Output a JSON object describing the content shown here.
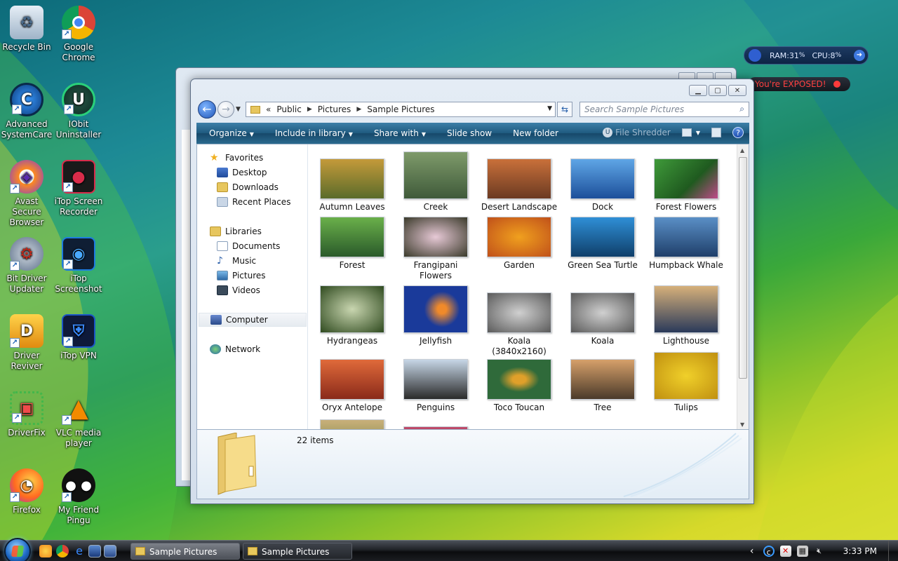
{
  "desktop": {
    "icons": [
      {
        "label": "Recycle Bin",
        "icon": "recycle-bin-icon",
        "color": "#7fa6c8"
      },
      {
        "label": "Google Chrome",
        "icon": "chrome-icon",
        "color": "#e14b3b"
      },
      {
        "label": "Advanced SystemCare",
        "icon": "advanced-systemcare-icon",
        "color": "#1a7bd6"
      },
      {
        "label": "IObit Uninstaller",
        "icon": "iobit-uninstaller-icon",
        "color": "#1c9c5a"
      },
      {
        "label": "Avast Secure Browser",
        "icon": "avast-browser-icon",
        "color": "#ff7a00"
      },
      {
        "label": "iTop Screen Recorder",
        "icon": "itop-screen-recorder-icon",
        "color": "#d92c4a"
      },
      {
        "label": "Bit Driver Updater",
        "icon": "bit-driver-updater-icon",
        "color": "#5b6e88"
      },
      {
        "label": "iTop Screenshot",
        "icon": "itop-screenshot-icon",
        "color": "#1d7de0"
      },
      {
        "label": "Driver Reviver",
        "icon": "driver-reviver-icon",
        "color": "#f0a21e"
      },
      {
        "label": "iTop VPN",
        "icon": "itop-vpn-icon",
        "color": "#1b56c7"
      },
      {
        "label": "DriverFix",
        "icon": "driverfix-icon",
        "color": "#43b74a"
      },
      {
        "label": "VLC media player",
        "icon": "vlc-icon",
        "color": "#f28a00"
      },
      {
        "label": "Firefox",
        "icon": "firefox-icon",
        "color": "#ff6a1f"
      },
      {
        "label": "My Friend Pingu",
        "icon": "pingu-icon",
        "color": "#111111"
      }
    ]
  },
  "gadgets": {
    "ram_label": "RAM:31",
    "ram_unit": "%",
    "cpu_label": "CPU:8",
    "cpu_unit": "%",
    "exposed": "You're EXPOSED!"
  },
  "window": {
    "address": {
      "prefix": "«",
      "crumbs": [
        "Public",
        "Pictures",
        "Sample Pictures"
      ]
    },
    "search_placeholder": "Search Sample Pictures",
    "toolbar": {
      "organize": "Organize",
      "include": "Include in library",
      "share": "Share with",
      "slideshow": "Slide show",
      "newfolder": "New folder",
      "shredder": "File Shredder"
    },
    "nav": {
      "favorites": "Favorites",
      "desktop": "Desktop",
      "downloads": "Downloads",
      "recent": "Recent Places",
      "libraries": "Libraries",
      "documents": "Documents",
      "music": "Music",
      "pictures": "Pictures",
      "videos": "Videos",
      "computer": "Computer",
      "network": "Network"
    },
    "items": [
      {
        "label": "Autumn Leaves",
        "c1": "#c49a3a",
        "c2": "#5a6b2a"
      },
      {
        "label": "Creek",
        "c1": "#7e9a6a",
        "c2": "#3f5a3a"
      },
      {
        "label": "Desert Landscape",
        "c1": "#c9703a",
        "c2": "#6b3a22"
      },
      {
        "label": "Dock",
        "c1": "#5fa6e6",
        "c2": "#1c4f9a"
      },
      {
        "label": "Forest Flowers",
        "c1": "#3f9a3a",
        "c2": "#c04a8a"
      },
      {
        "label": "Forest",
        "c1": "#6ab04a",
        "c2": "#2a5a2a"
      },
      {
        "label": "Frangipani Flowers",
        "c1": "#e7c9d6",
        "c2": "#3a3a2a"
      },
      {
        "label": "Garden",
        "c1": "#f0a01e",
        "c2": "#c0501a"
      },
      {
        "label": "Green Sea Turtle",
        "c1": "#2f8fd6",
        "c2": "#0f3f6a"
      },
      {
        "label": "Humpback Whale",
        "c1": "#5a8fc6",
        "c2": "#1f3f6a"
      },
      {
        "label": "Hydrangeas",
        "c1": "#c9d6b0",
        "c2": "#2f4a1f"
      },
      {
        "label": "Jellyfish",
        "c1": "#1a3a9a",
        "c2": "#f08a2a"
      },
      {
        "label": "Koala (3840x2160)",
        "c1": "#b0b0b0",
        "c2": "#5a5a5a"
      },
      {
        "label": "Koala",
        "c1": "#b0b0b0",
        "c2": "#5a5a5a"
      },
      {
        "label": "Lighthouse",
        "c1": "#d6b07a",
        "c2": "#2a3a5a"
      },
      {
        "label": "Oryx Antelope",
        "c1": "#e06a3a",
        "c2": "#8a2a1a"
      },
      {
        "label": "Penguins",
        "c1": "#c6d6e6",
        "c2": "#2a2a2a"
      },
      {
        "label": "Toco Toucan",
        "c1": "#2f6a3a",
        "c2": "#e0a02a"
      },
      {
        "label": "Tree",
        "c1": "#d6a06a",
        "c2": "#4a3a2a"
      },
      {
        "label": "Tulips",
        "c1": "#f0d02a",
        "c2": "#c09010"
      }
    ],
    "count": "22 items"
  },
  "taskbar": {
    "btn1": "Sample Pictures",
    "btn2": "Sample Pictures",
    "clock": "3:33 PM",
    "tray_expand": "‹"
  }
}
